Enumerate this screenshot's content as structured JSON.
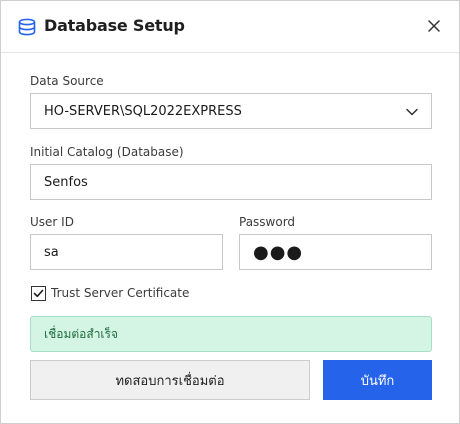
{
  "dialog": {
    "title": "Database Setup",
    "title_icon": "database-icon",
    "close_icon": "close-icon"
  },
  "form": {
    "data_source": {
      "label": "Data Source",
      "value": "HO-SERVER\\SQL2022EXPRESS",
      "icon": "chevron-down-icon"
    },
    "initial_catalog": {
      "label": "Initial Catalog (Database)",
      "value": "Senfos"
    },
    "user_id": {
      "label": "User ID",
      "value": "sa"
    },
    "password": {
      "label": "Password",
      "masked_value": "●●●"
    },
    "trust_cert": {
      "label": "Trust Server Certificate",
      "checked": true
    }
  },
  "status": {
    "message": "เชื่อมต่อสำเร็จ",
    "color": "#d5f5e4"
  },
  "buttons": {
    "test_connection": "ทดสอบการเชื่อมต่อ",
    "save": "บันทึก"
  },
  "colors": {
    "accent": "#2563eb",
    "success_bg": "#d5f5e4",
    "success_text": "#1e6b3f"
  }
}
